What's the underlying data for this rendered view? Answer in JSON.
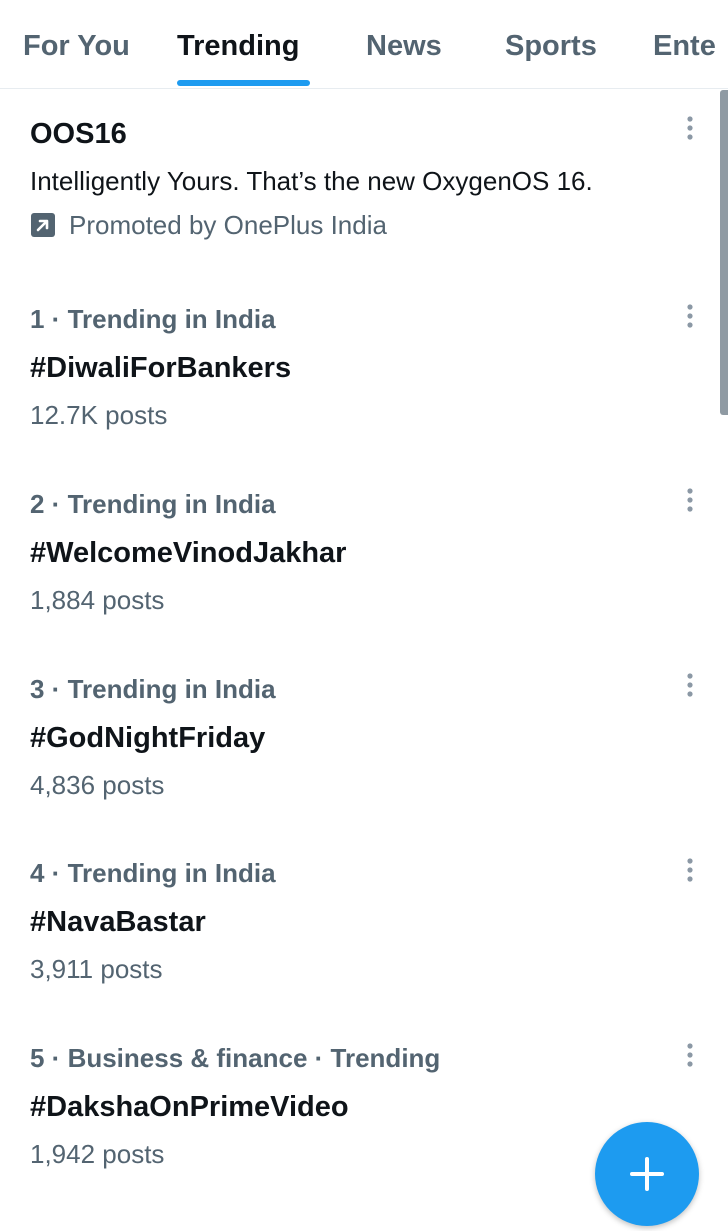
{
  "tabs": [
    {
      "label": "For You",
      "active": false
    },
    {
      "label": "Trending",
      "active": true
    },
    {
      "label": "News",
      "active": false
    },
    {
      "label": "Sports",
      "active": false
    },
    {
      "label": "Ente",
      "active": false
    }
  ],
  "promoted": {
    "title": "OOS16",
    "text": "Intelligently Yours. That’s the new OxygenOS 16.",
    "promoted_by": "Promoted by OnePlus India",
    "icon": "promoted-arrow-icon"
  },
  "trends": [
    {
      "meta": "1 · Trending in India",
      "headline": "#DiwaliForBankers",
      "count": "12.7K posts"
    },
    {
      "meta": "2 · Trending in India",
      "headline": "#WelcomeVinodJakhar",
      "count": "1,884 posts"
    },
    {
      "meta": "3 · Trending in India",
      "headline": "#GodNightFriday",
      "count": "4,836 posts"
    },
    {
      "meta": "4 · Trending in India",
      "headline": "#NavaBastar",
      "count": "3,911 posts"
    },
    {
      "meta": "5 · Business & finance · Trending",
      "headline": "#DakshaOnPrimeVideo",
      "count": "1,942 posts"
    }
  ],
  "colors": {
    "accent": "#1d9bf0",
    "text_primary": "#0f1419",
    "text_secondary": "#536471"
  },
  "icons": {
    "more": "more-vertical-icon",
    "compose": "plus-icon"
  }
}
